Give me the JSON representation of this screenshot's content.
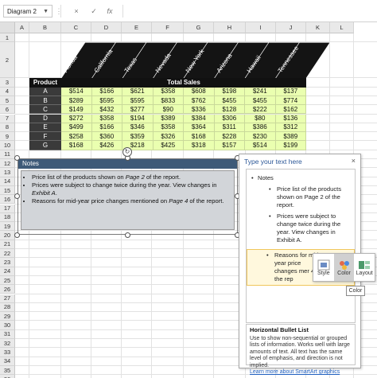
{
  "formula_bar": {
    "name_box": "Diagram 2",
    "cancel_icon": "×",
    "enter_icon": "✓",
    "fx_label": "fx"
  },
  "columns": [
    "A",
    "B",
    "C",
    "D",
    "E",
    "F",
    "G",
    "H",
    "I",
    "J",
    "K",
    "L"
  ],
  "rows": [
    "1",
    "2",
    "3",
    "4",
    "5",
    "6",
    "7",
    "8",
    "9",
    "10",
    "11",
    "12",
    "13",
    "14",
    "15",
    "16",
    "17",
    "18",
    "19",
    "20",
    "21",
    "22",
    "23",
    "24",
    "25",
    "26",
    "27",
    "28",
    "29",
    "30",
    "31",
    "32",
    "33",
    "34",
    "35",
    "36",
    "37"
  ],
  "table": {
    "product_header": "Product",
    "total_header": "Total Sales",
    "states": [
      "Florida",
      "California",
      "Texas",
      "Nevada",
      "New York",
      "Arizona",
      "Hawaii",
      "Tennessee"
    ],
    "products": [
      {
        "name": "A",
        "values": [
          "$514",
          "$166",
          "$621",
          "$358",
          "$608",
          "$198",
          "$241",
          "$137"
        ]
      },
      {
        "name": "B",
        "values": [
          "$289",
          "$595",
          "$595",
          "$833",
          "$762",
          "$455",
          "$455",
          "$774"
        ]
      },
      {
        "name": "C",
        "values": [
          "$149",
          "$432",
          "$277",
          "$90",
          "$336",
          "$128",
          "$222",
          "$162"
        ]
      },
      {
        "name": "D",
        "values": [
          "$272",
          "$358",
          "$194",
          "$389",
          "$384",
          "$306",
          "$80",
          "$136"
        ]
      },
      {
        "name": "E",
        "values": [
          "$499",
          "$166",
          "$346",
          "$358",
          "$364",
          "$311",
          "$386",
          "$312"
        ]
      },
      {
        "name": "F",
        "values": [
          "$258",
          "$360",
          "$359",
          "$326",
          "$168",
          "$228",
          "$230",
          "$389"
        ]
      },
      {
        "name": "G",
        "values": [
          "$168",
          "$426",
          "$218",
          "$425",
          "$318",
          "$157",
          "$514",
          "$199"
        ]
      }
    ]
  },
  "notes": {
    "title": "Notes",
    "bullet1_a": "Price list of the products shown on ",
    "bullet1_b": "Page 2",
    "bullet1_c": " of the report.",
    "bullet2_a": "Prices were subject to change twice during the year. View changes in ",
    "bullet2_b": "Exhibit A",
    "bullet2_c": ".",
    "bullet3_a": "Reasons for mid-year price changes mentioned on ",
    "bullet3_b": "Page 4",
    "bullet3_c": " of the report."
  },
  "text_pane": {
    "title": "Type your text here",
    "close": "×",
    "item_notes": "Notes",
    "item1": "Price list of the products shown on Page 2 of the report.",
    "item2": "Prices were subject to change twice during the year. View changes in Exhibit A.",
    "item3": "Reasons for mid-year price changes mer 4 of the rep",
    "info_title": "Horizontal Bullet List",
    "info_text": "Use to show non-sequential or grouped lists of information. Works well with large amounts of text. All text has the same level of emphasis, and direction is not implied.",
    "info_link": "Learn more about SmartArt graphics"
  },
  "mini_toolbar": {
    "style": "Style",
    "color": "Color",
    "layout": "Layout",
    "tooltip": "Color"
  }
}
